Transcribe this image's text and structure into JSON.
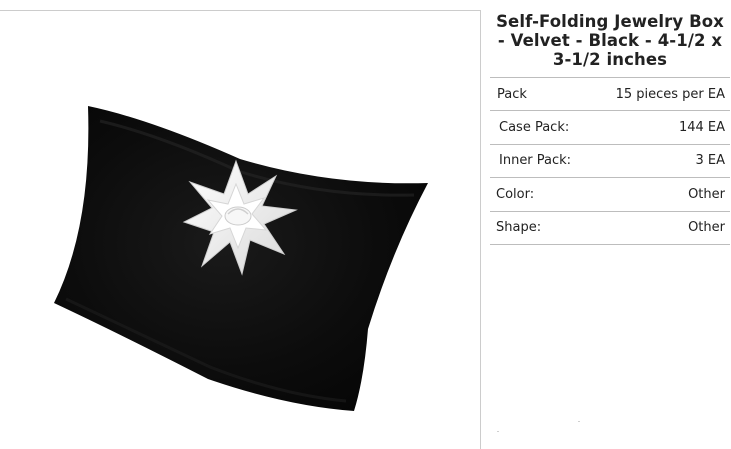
{
  "product": {
    "title": "Self-Folding Jewelry Box - Velvet - Black - 4-1/2 x 3-1/2 inches",
    "image": {
      "description_icon": "black-velvet-pillow-box-with-white-bow-icon"
    },
    "specs": [
      {
        "label": "Pack",
        "value": "15 pieces per EA"
      },
      {
        "label": "Case Pack:",
        "value": "144 EA"
      },
      {
        "label": "Inner Pack:",
        "value": "3 EA"
      },
      {
        "label": "Color:",
        "value": "Other"
      },
      {
        "label": "Shape:",
        "value": "Other"
      }
    ]
  },
  "colors": {
    "box": "#0b0b0b",
    "bow": "#f4f4f4",
    "divider": "#bdbdbd"
  }
}
